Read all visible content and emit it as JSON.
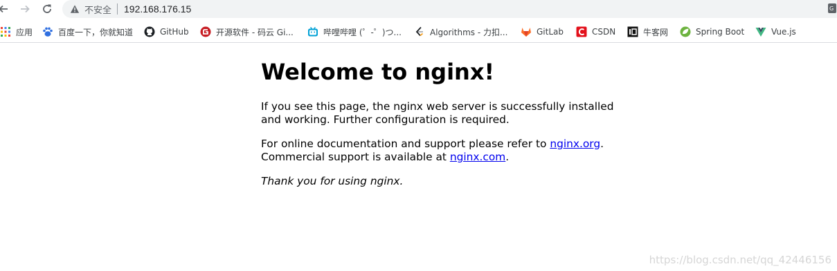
{
  "browser": {
    "security_label": "不安全",
    "url": "192.168.176.15",
    "bookmarks": [
      {
        "label": "应用",
        "icon": "apps-grid-icon"
      },
      {
        "label": "百度一下，你就知道",
        "icon": "baidu-paw-icon"
      },
      {
        "label": "GitHub",
        "icon": "github-icon"
      },
      {
        "label": "开源软件 - 码云 Gi...",
        "icon": "gitee-icon"
      },
      {
        "label": "哔哩哔哩 (゜-゜)つ...",
        "icon": "bilibili-icon"
      },
      {
        "label": "Algorithms - 力扣...",
        "icon": "leetcode-icon"
      },
      {
        "label": "GitLab",
        "icon": "gitlab-icon"
      },
      {
        "label": "CSDN",
        "icon": "csdn-icon"
      },
      {
        "label": "牛客网",
        "icon": "nowcoder-icon"
      },
      {
        "label": "Spring Boot",
        "icon": "spring-icon"
      },
      {
        "label": "Vue.js",
        "icon": "vue-icon"
      }
    ]
  },
  "page": {
    "heading": "Welcome to nginx!",
    "p1": "If you see this page, the nginx web server is successfully installed and working. Further configuration is required.",
    "p2_prefix": "For online documentation and support please refer to ",
    "p2_link1": "nginx.org",
    "p2_mid": ".",
    "p2_line2_prefix": "Commercial support is available at ",
    "p2_link2": "nginx.com",
    "p2_suffix": ".",
    "p3": "Thank you for using nginx."
  },
  "watermark": "https://blog.csdn.net/qq_42446156"
}
